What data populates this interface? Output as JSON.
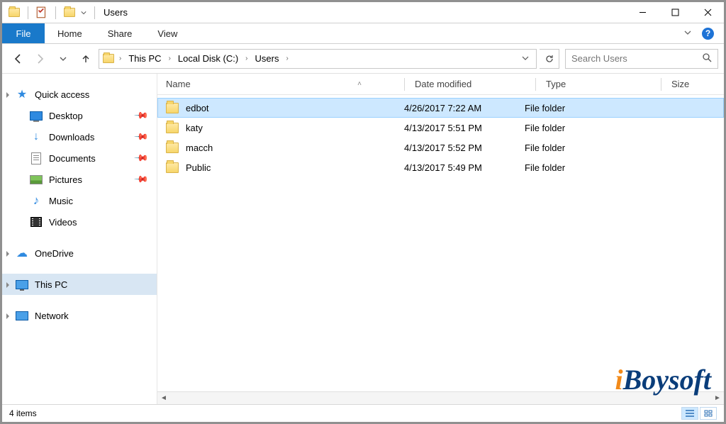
{
  "window": {
    "title": "Users"
  },
  "ribbon": {
    "file": "File",
    "tabs": [
      "Home",
      "Share",
      "View"
    ]
  },
  "address": {
    "crumbs": [
      "This PC",
      "Local Disk (C:)",
      "Users"
    ]
  },
  "search": {
    "placeholder": "Search Users"
  },
  "sidebar": {
    "quick_access": {
      "label": "Quick access"
    },
    "quick_items": [
      {
        "label": "Desktop",
        "pinned": true,
        "icon": "desktop"
      },
      {
        "label": "Downloads",
        "pinned": true,
        "icon": "downloads"
      },
      {
        "label": "Documents",
        "pinned": true,
        "icon": "documents"
      },
      {
        "label": "Pictures",
        "pinned": true,
        "icon": "pictures"
      },
      {
        "label": "Music",
        "pinned": false,
        "icon": "music"
      },
      {
        "label": "Videos",
        "pinned": false,
        "icon": "videos"
      }
    ],
    "onedrive": {
      "label": "OneDrive"
    },
    "this_pc": {
      "label": "This PC",
      "selected": true
    },
    "network": {
      "label": "Network"
    }
  },
  "columns": {
    "name": "Name",
    "date": "Date modified",
    "type": "Type",
    "size": "Size"
  },
  "files": [
    {
      "name": "edbot",
      "date": "4/26/2017 7:22 AM",
      "type": "File folder",
      "size": "",
      "selected": true
    },
    {
      "name": "katy",
      "date": "4/13/2017 5:51 PM",
      "type": "File folder",
      "size": "",
      "selected": false
    },
    {
      "name": "macch",
      "date": "4/13/2017 5:52 PM",
      "type": "File folder",
      "size": "",
      "selected": false
    },
    {
      "name": "Public",
      "date": "4/13/2017 5:49 PM",
      "type": "File folder",
      "size": "",
      "selected": false
    }
  ],
  "status": {
    "count": "4 items"
  },
  "watermark": "iBoysoft"
}
